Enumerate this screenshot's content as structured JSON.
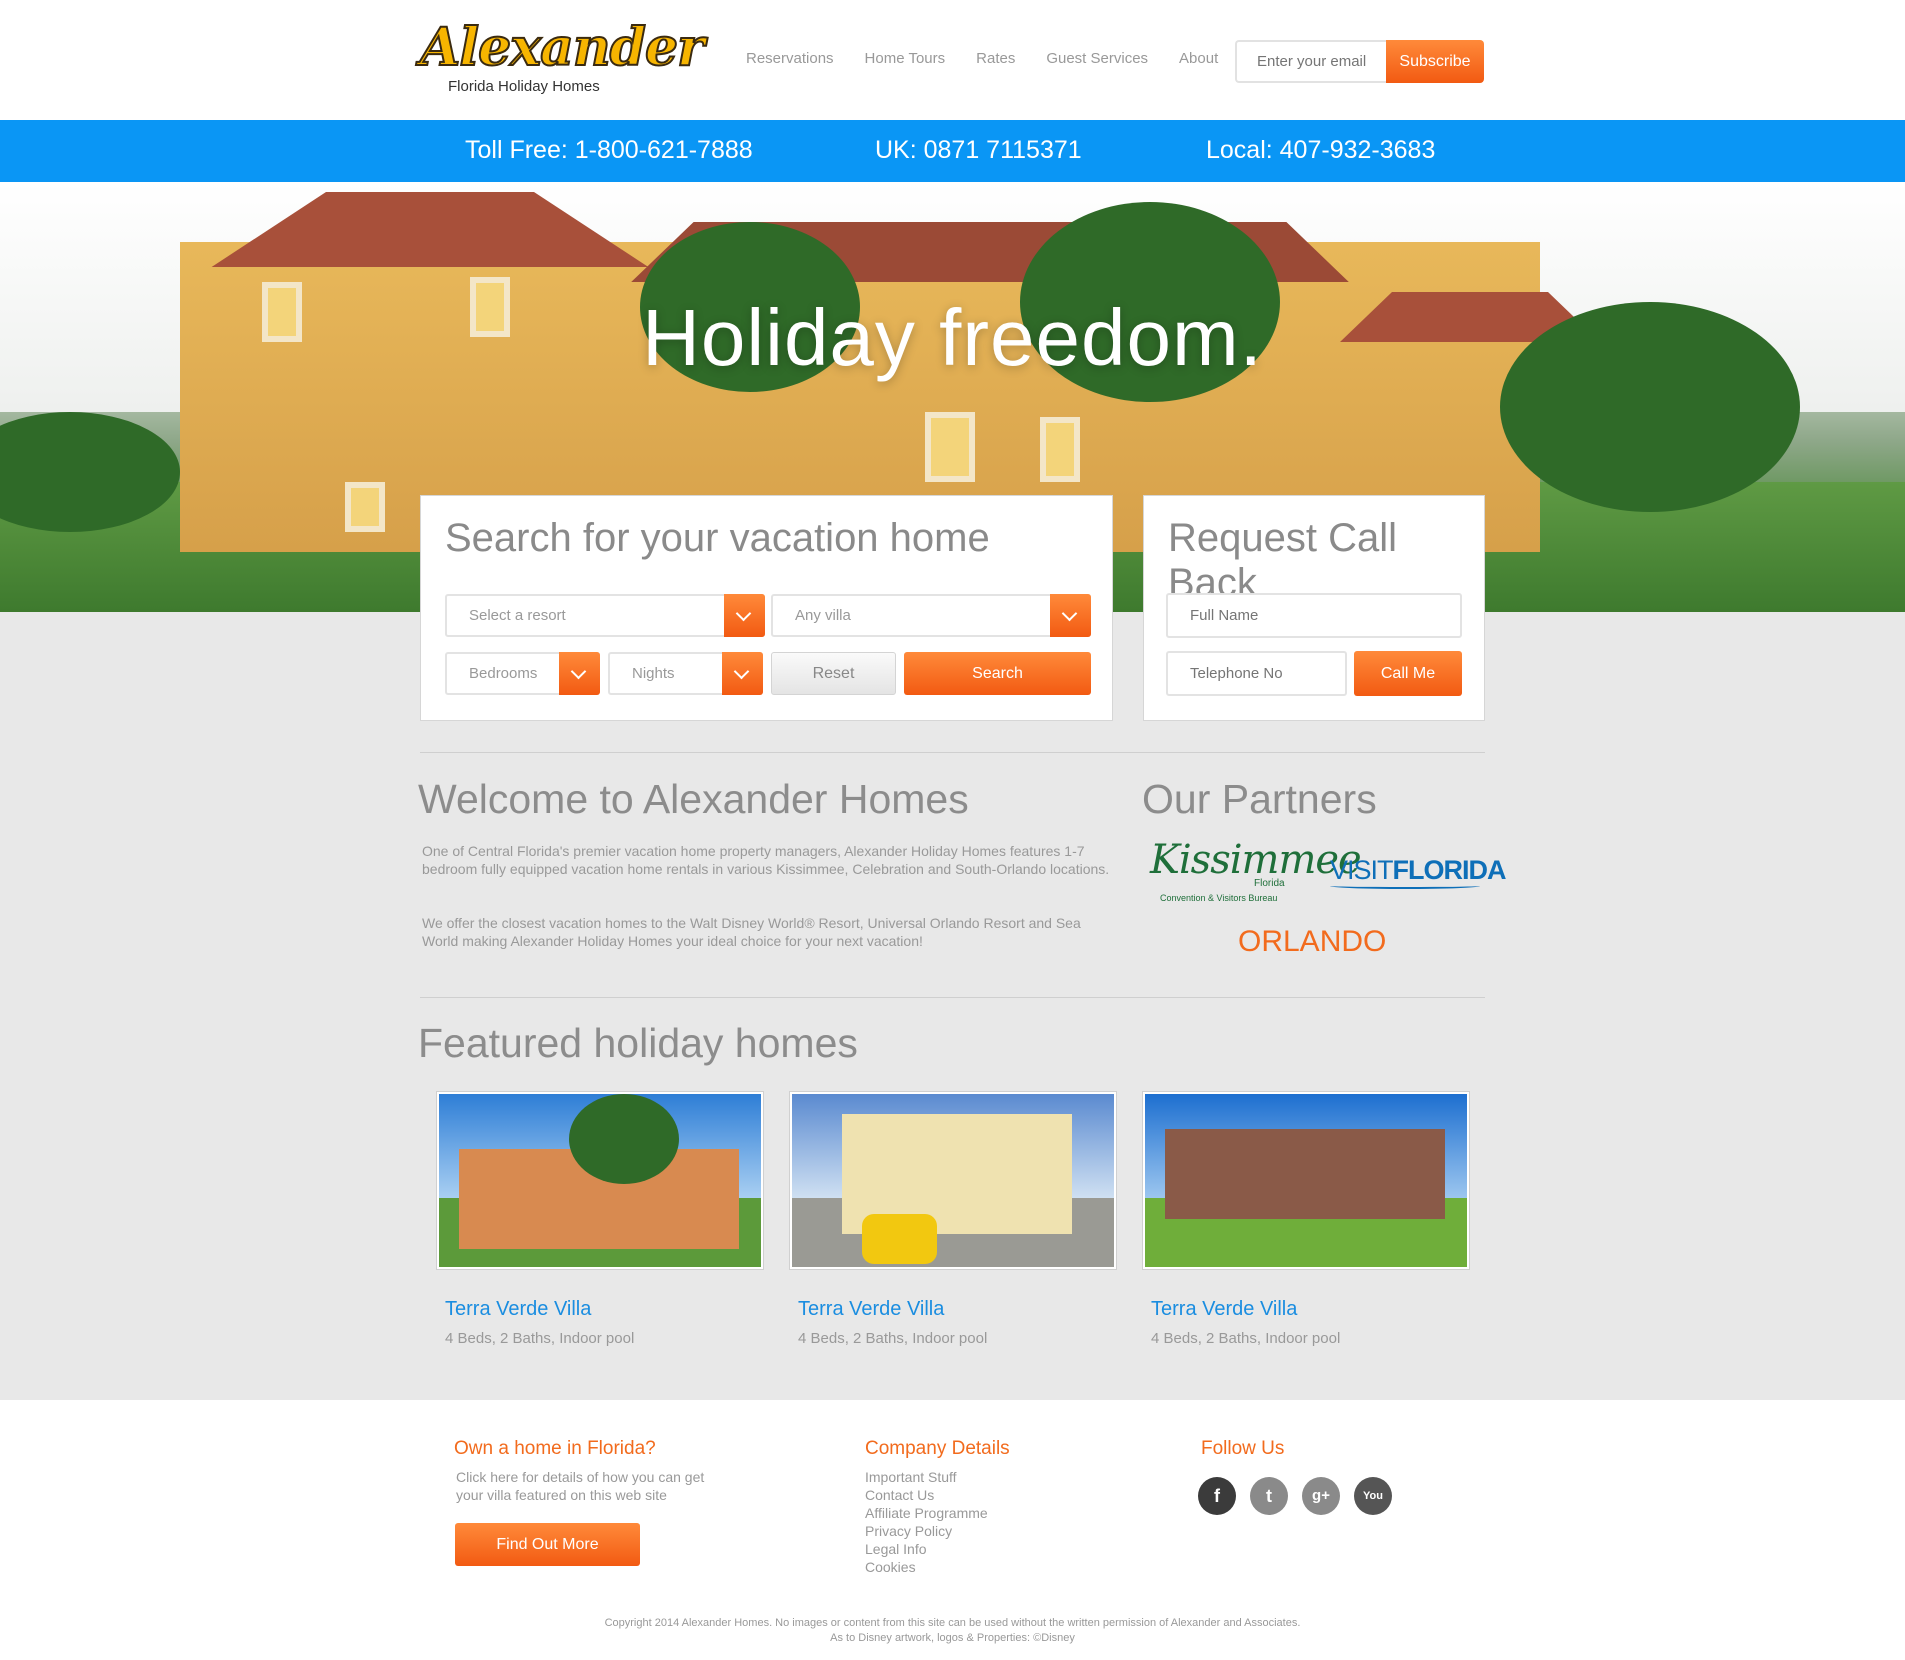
{
  "header": {
    "logo_word": "Alexander",
    "logo_sub": "Florida Holiday Homes",
    "nav": [
      "Reservations",
      "Home Tours",
      "Rates",
      "Guest Services",
      "About"
    ],
    "email_placeholder": "Enter your email",
    "subscribe_label": "Subscribe"
  },
  "phones": {
    "toll_free": "Toll Free: 1-800-621-7888",
    "uk": "UK: 0871 7115371",
    "local": "Local: 407-932-3683"
  },
  "hero": {
    "title": "Holiday freedom."
  },
  "search": {
    "title": "Search for your vacation home",
    "resort": "Select a resort",
    "villa": "Any villa",
    "bedrooms": "Bedrooms",
    "nights": "Nights",
    "reset_label": "Reset",
    "search_label": "Search"
  },
  "callback": {
    "title": "Request Call Back",
    "name_placeholder": "Full Name",
    "phone_placeholder": "Telephone No",
    "button_label": "Call Me"
  },
  "welcome": {
    "title": "Welcome to Alexander Homes",
    "p1": "One of Central Florida's premier vacation home property managers, Alexander Holiday Homes features 1-7 bedroom fully equipped vacation home rentals in various Kissimmee, Celebration and South-Orlando locations.",
    "p2": "We offer the closest vacation homes to the Walt Disney World® Resort, Universal Orlando Resort and Sea World making Alexander Holiday Homes your ideal choice for your next vacation!"
  },
  "partners": {
    "title": "Our Partners",
    "kissimmee": "Kissimmee",
    "kissimmee_state": "Florida",
    "kissimmee_sub": "Convention & Visitors Bureau",
    "visit_a": "VISIT",
    "visit_b": "FLORIDA",
    "orlando": "ORLANDO"
  },
  "featured": {
    "title": "Featured holiday homes",
    "homes": [
      {
        "name": "Terra Verde Villa",
        "desc": "4 Beds, 2 Baths, Indoor pool"
      },
      {
        "name": "Terra Verde Villa",
        "desc": "4 Beds, 2 Baths, Indoor pool"
      },
      {
        "name": "Terra Verde Villa",
        "desc": "4 Beds, 2 Baths, Indoor pool"
      }
    ]
  },
  "footer": {
    "own_title": "Own a home in Florida?",
    "own_text": "Click here for details of how you can get your villa featured on this web site",
    "find_out_label": "Find Out More",
    "company_title": "Company Details",
    "links": [
      "Important Stuff",
      "Contact Us",
      "Affiliate Programme",
      "Privacy Policy",
      "Legal Info",
      "Cookies"
    ],
    "follow_title": "Follow Us",
    "social": [
      {
        "icon": "facebook-icon",
        "glyph": "f",
        "color": "#3b3b3b"
      },
      {
        "icon": "twitter-icon",
        "glyph": "t",
        "color": "#8a8a8a"
      },
      {
        "icon": "google-plus-icon",
        "glyph": "g+",
        "color": "#8a8a8a"
      },
      {
        "icon": "youtube-icon",
        "glyph": "You",
        "color": "#555555"
      }
    ],
    "copyright_1": "Copyright 2014 Alexander Homes. No images or content from this site can be used without the written permission of Alexander and Associates.",
    "copyright_2": "As to Disney artwork, logos & Properties: ©Disney"
  },
  "colors": {
    "accent": "#f25a12",
    "blue_bar": "#0a96f5",
    "link_blue": "#1a8de0"
  }
}
